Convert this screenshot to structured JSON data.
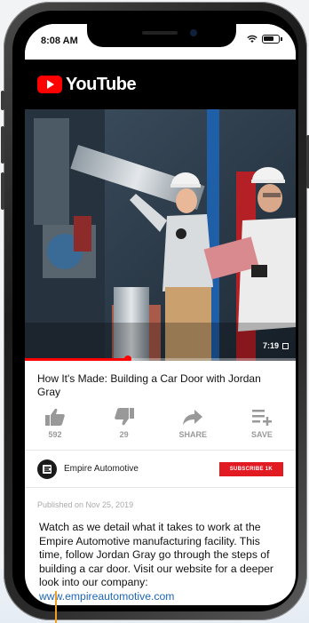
{
  "status": {
    "time": "8:08 AM"
  },
  "app": {
    "name": "YouTube"
  },
  "video": {
    "duration": "7:19",
    "progress": 0.38,
    "title": "How It's Made: Building a Car Door with Jordan Gray"
  },
  "actions": [
    {
      "icon": "thumbs-up-icon",
      "label": "592"
    },
    {
      "icon": "thumbs-down-icon",
      "label": "29"
    },
    {
      "icon": "share-icon",
      "label": "SHARE"
    },
    {
      "icon": "save-playlist-icon",
      "label": "SAVE"
    }
  ],
  "channel": {
    "name": "Empire Automotive",
    "subscribe_label": "SUBSCRIBE 1K",
    "avatar_letter": "E"
  },
  "published": "Published on Nov 25, 2019",
  "description": {
    "text": "Watch as we detail what it takes to work at the Empire Automotive manufacturing facility. This time, follow Jordan Gray go through the steps of building a car door. Visit our website for a deeper look into our company: ",
    "link": "www.empireautomotive.com"
  },
  "colors": {
    "accent": "#ff0000",
    "subscribe": "#e21b23",
    "link": "#1d66b5"
  }
}
